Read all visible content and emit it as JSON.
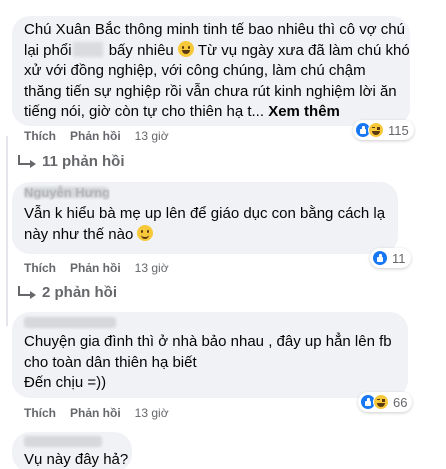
{
  "comments": [
    {
      "text_lines": [
        [
          "Chú Xuân Bắc thông minh tinh tế bao nhiêu thì cô vợ chú"
        ],
        [
          "lại phổi",
          "bấy nhiêu"
        ],
        [
          "xử với đồng nghiệp, với công chúng, làm chú chậm"
        ],
        [
          "thăng tiến sự nghiệp rồi vẫn chưa rút kinh nghiệm lời ăn"
        ],
        [
          "tiếng nói, giờ còn tự cho thiên hạ t..."
        ]
      ],
      "line2_tail": "Từ vụ ngày xưa đã làm chú khó",
      "see_more": "Xem thêm",
      "actions": {
        "like": "Thích",
        "reply": "Phản hồi",
        "time": "13 giờ"
      },
      "reaction_count": "115",
      "replies_label": "11 phản hồi"
    },
    {
      "author": "Nguyễn Hưng",
      "text_lines": [
        "Vẫn k hiểu bà mẹ up lên để giáo dục con bằng cách lạ",
        "này như thế nào"
      ],
      "actions": {
        "like": "Thích",
        "reply": "Phản hồi",
        "time": "13 giờ"
      },
      "reaction_count": "11",
      "replies_label": "2 phản hồi"
    },
    {
      "text_lines": [
        "Chuyện gia đình thì ở nhà bảo nhau , đây up hẳn lên fb",
        "cho toàn dân thiên hạ biết",
        "Đến chịu =))"
      ],
      "actions": {
        "like": "Thích",
        "reply": "Phản hồi",
        "time": "13 giờ"
      },
      "reaction_count": "66"
    },
    {
      "text_lines": [
        "Vụ này đây hả?"
      ]
    }
  ],
  "colors": {
    "bubble": "#f0f2f5",
    "secondary_text": "#65676b",
    "like_blue": "#1877f2",
    "haha_yellow": "#f7c83a"
  },
  "icons": {
    "like": "like-reaction-icon",
    "haha": "haha-reaction-icon",
    "reply_arrow": "reply-arrow-icon",
    "smile": "smile-emoji-icon",
    "laugh": "laugh-emoji-icon"
  }
}
